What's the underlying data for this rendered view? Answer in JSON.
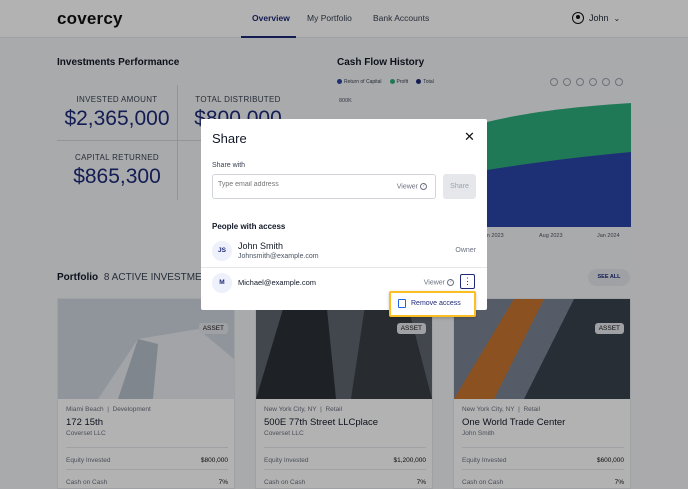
{
  "header": {
    "logo": "covercy",
    "nav": [
      {
        "label": "Overview",
        "active": true
      },
      {
        "label": "My Portfolio",
        "active": false
      },
      {
        "label": "Bank Accounts",
        "active": false
      }
    ],
    "user": "John"
  },
  "investments": {
    "title": "Investments Performance",
    "stats": [
      {
        "label": "INVESTED AMOUNT",
        "value": "$2,365,000"
      },
      {
        "label": "TOTAL DISTRIBUTED",
        "value": "$800,000"
      },
      {
        "label": "CAPITAL RETURNED",
        "value": "$865,300"
      }
    ]
  },
  "cashflow": {
    "title": "Cash Flow History",
    "legend": [
      {
        "name": "Return of Capital",
        "color": "#2b46a8"
      },
      {
        "name": "Profit",
        "color": "#2fae7c"
      },
      {
        "name": "Total",
        "color": "#1e2a78"
      }
    ],
    "y_tick": "800K",
    "x_ticks": [
      "Jan 2023",
      "Aug 2023",
      "Jan 2024"
    ]
  },
  "portfolio": {
    "title": "Portfolio",
    "count": "8 ACTIVE INVESTMENT",
    "see_all": "SEE ALL",
    "cards": [
      {
        "badge": "ASSET",
        "city": "Miami Beach",
        "type": "Development",
        "name": "172 15th",
        "owner": "Coverset LLC",
        "equity_label": "Equity Invested",
        "equity": "$800,000",
        "coc_label": "Cash on Cash",
        "coc": "7%"
      },
      {
        "badge": "ASSET",
        "city": "New York City, NY",
        "type": "Retail",
        "name": "500E 77th Street LLCplace",
        "owner": "Coverset LLC",
        "equity_label": "Equity Invested",
        "equity": "$1,200,000",
        "coc_label": "Cash on Cash",
        "coc": "7%"
      },
      {
        "badge": "ASSET",
        "city": "New York City, NY",
        "type": "Retail",
        "name": "One World Trade Center",
        "owner": "John Smith",
        "equity_label": "Equity Invested",
        "equity": "$600,000",
        "coc_label": "Cash on Cash",
        "coc": "7%"
      }
    ]
  },
  "share_modal": {
    "title": "Share",
    "share_with_label": "Share with",
    "email_placeholder": "Type email address",
    "role_default": "Viewer",
    "share_button": "Share",
    "people_title": "People with access",
    "people": [
      {
        "initials": "JS",
        "name": "John Smith",
        "email": "Johnsmith@example.com",
        "role": "Owner"
      },
      {
        "initials": "M",
        "email": "Michael@example.com",
        "role": "Viewer"
      }
    ],
    "menu_item": "Remove access"
  },
  "colors": {
    "accent": "#1e2a78",
    "highlight": "#fbbf24"
  }
}
